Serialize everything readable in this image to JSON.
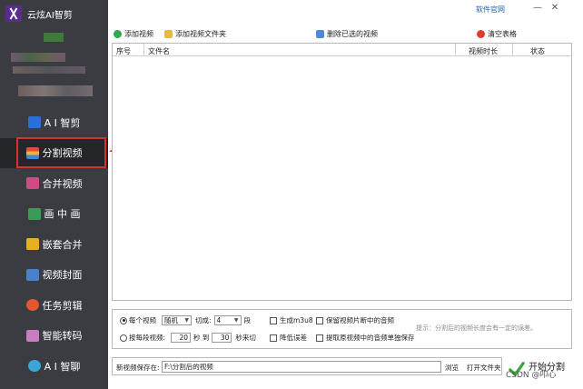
{
  "app": {
    "title": "云炫AI智剪"
  },
  "topbar": {
    "link": "软件官网",
    "minimize": "—",
    "close": "✕"
  },
  "nav": {
    "items": [
      {
        "label": "A I 智剪",
        "icon": "ai-cut-icon",
        "color": "#2b6fd6"
      },
      {
        "label": "分割视频",
        "icon": "split-video-icon",
        "color": "#e24a3b",
        "active": true
      },
      {
        "label": "合并视频",
        "icon": "merge-video-icon",
        "color": "#d04a86"
      },
      {
        "label": "画 中 画",
        "icon": "picture-in-picture-icon",
        "color": "#3c9a58"
      },
      {
        "label": "嵌套合并",
        "icon": "nest-merge-icon",
        "color": "#e6b01e"
      },
      {
        "label": "视频封面",
        "icon": "video-cover-icon",
        "color": "#4a82c9"
      },
      {
        "label": "任务剪辑",
        "icon": "task-edit-icon",
        "color": "#e4572e"
      },
      {
        "label": "智能转码",
        "icon": "smart-transcode-icon",
        "color": "#c77dc0"
      },
      {
        "label": "A I 智聊",
        "icon": "ai-chat-icon",
        "color": "#3aa6d8"
      }
    ]
  },
  "toolbar": {
    "add_video": "添加视频",
    "add_folder": "添加视频文件夹",
    "delete_selected": "删除已选的视频",
    "clear_table": "清空表格"
  },
  "table": {
    "columns": [
      "序号",
      "文件名",
      "视频时长",
      "状态"
    ],
    "rows": []
  },
  "options": {
    "per_video": "每个视频",
    "mode_value": "随机",
    "cut_into": "切成:",
    "count_value": "4",
    "segments": "段",
    "per_segment": "按每段视频:",
    "from_value": "20",
    "sec_to": "秒 到",
    "to_value": "30",
    "sec_cut": "秒来切",
    "generate_m3u8": "生成m3u8",
    "keep_audio": "保留视频片断中的音频",
    "reduce_error": "降低误差",
    "extract_audio": "提取原视频中的音频单独保存",
    "hint": "提示：分割后的视频长度会有一定的误差。"
  },
  "bottom": {
    "save_label": "新视频保存在:",
    "save_path": "F:\\分割后的视频",
    "browse": "浏览",
    "open_folder": "打开文件夹",
    "start": "开始分割",
    "watermark": "CSDN @叩心"
  },
  "colors": {
    "sidebar": "#3a3c42",
    "accent_red": "#d9322e",
    "link": "#1a5fb4"
  }
}
